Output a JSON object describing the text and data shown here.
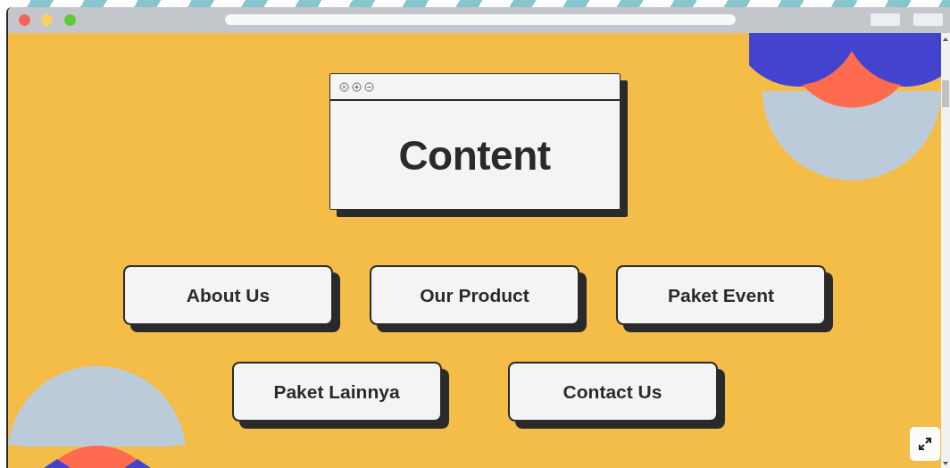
{
  "content_window": {
    "title": "Content"
  },
  "menu_rows": [
    {
      "buttons": [
        {
          "label": "About Us"
        },
        {
          "label": "Our Product"
        },
        {
          "label": "Paket Event"
        }
      ]
    },
    {
      "buttons": [
        {
          "label": "Paket Lainnya"
        },
        {
          "label": "Contact Us"
        }
      ]
    }
  ]
}
